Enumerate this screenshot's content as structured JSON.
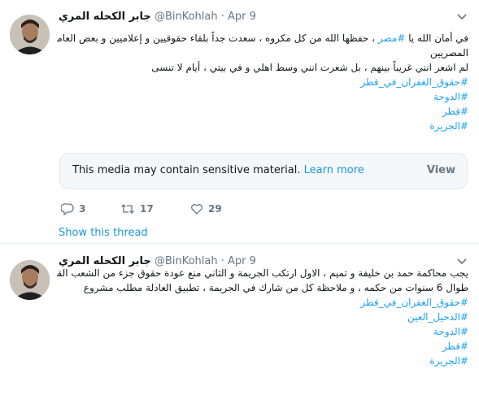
{
  "tweets": [
    {
      "author_name": "جابر الكحله المري",
      "handle": "@BinKohlah",
      "separator": "·",
      "date": "Apr 9",
      "text_lines": [
        {
          "prefix": "في أمان الله يا ",
          "hashtag": "#مصر",
          "suffix": " ، حفظها الله من كل مكروه ، سعدت جداً بلقاء حقوقيين و إعلاميين و بعض العامة من"
        },
        {
          "prefix": "المصريين",
          "hashtag": "",
          "suffix": ""
        },
        {
          "prefix": "لم اشعر انني غريباً بينهم ، بل شعرت انني وسط اهلي و في بيتي ، أيام لا تنسى",
          "hashtag": "",
          "suffix": ""
        }
      ],
      "hashtags": [
        "#حقوق_الغفران_في_قطر",
        "#الدوحة",
        "#قطر",
        "#الجزيرة"
      ],
      "sensitive": {
        "message": "This media may contain sensitive material.",
        "learn_more": "Learn more",
        "view": "View"
      },
      "actions": {
        "replies": "3",
        "retweets": "17",
        "likes": "29"
      },
      "show_thread": "Show this thread"
    },
    {
      "author_name": "جابر الكحله المري",
      "handle": "@BinKohlah",
      "separator": "·",
      "date": "Apr 9",
      "text_lines": [
        "يجب محاكمة حمد بن خليفة و تميم ، الاول ارتكب الجريمة و الثاني منع عودة حقوق جزء من الشعب القطري",
        "طوال 6 سنوات من حكمه ، و ملاحظة كل من شارك في الجريمة ، تطبيق العادلة مطلب مشروع"
      ],
      "hashtags": [
        "#حقوق_الغفران_في_قطر",
        "#الدحيل_العين",
        "#الدوحة",
        "#قطر",
        "#الجزيرة"
      ]
    }
  ],
  "colors": {
    "link": "#1da1f2",
    "secondary": "#657786",
    "border": "#e6ecf0"
  },
  "icons": [
    "reply-icon",
    "retweet-icon",
    "like-icon",
    "chevron-down-icon"
  ]
}
